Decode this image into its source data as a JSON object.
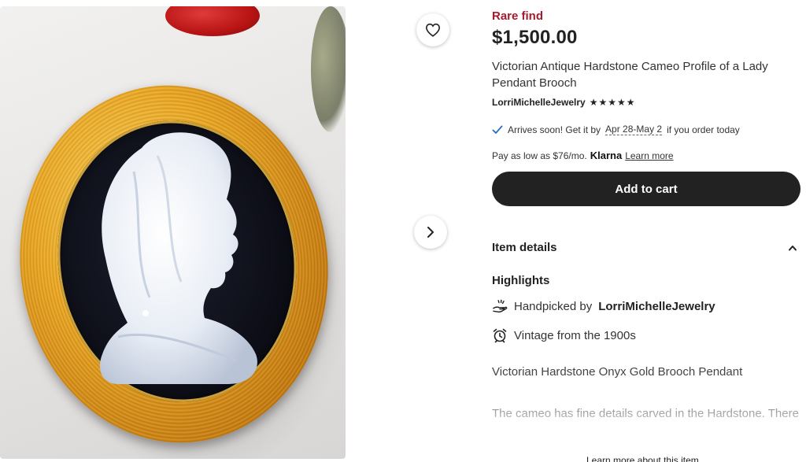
{
  "listing": {
    "badge": "Rare find",
    "price": "$1,500.00",
    "title": "Victorian Antique Hardstone Cameo Profile of a Lady Pendant Brooch",
    "shop_name": "LorriMichelleJewelry",
    "rating_stars": "★★★★★",
    "rating": 5
  },
  "delivery": {
    "prefix": "Arrives soon! Get it by",
    "dates": "Apr 28-May 2",
    "suffix": "if you order today"
  },
  "payment": {
    "text": "Pay as low as $76/mo.",
    "provider": "Klarna",
    "learn_more": "Learn more"
  },
  "actions": {
    "add_to_cart": "Add to cart"
  },
  "details": {
    "header": "Item details",
    "highlights_title": "Highlights",
    "handpicked_prefix": "Handpicked by",
    "handpicked_shop": "LorriMichelleJewelry",
    "vintage": "Vintage from the 1900s",
    "short_description": "Victorian Hardstone Onyx Gold Brooch Pendant",
    "long_description": "The cameo has fine details carved in the Hardstone. There",
    "learn_more_item": "Learn more about this item"
  },
  "icons": {
    "favorite": "heart-icon",
    "next": "chevron-right-icon",
    "check": "check-icon",
    "collapse": "chevron-up-icon",
    "handpicked": "hand-icon",
    "vintage": "alarm-clock-icon"
  },
  "colors": {
    "rare_find": "#a61a2e",
    "button_bg": "#222222",
    "check": "#2a6ebb"
  }
}
